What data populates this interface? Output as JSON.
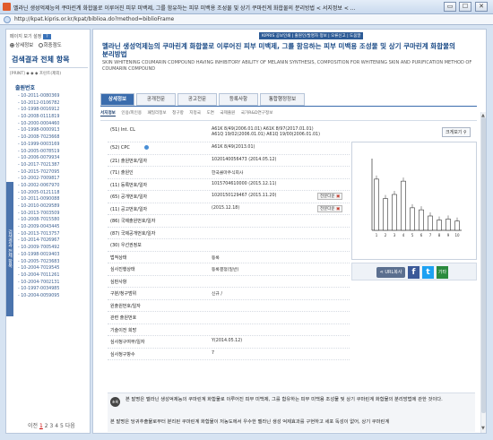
{
  "window": {
    "title": "멜라닌 생성억제능의 쿠마린계 화합물로 이루어진 피부 미백제, 그를 함유하는 피부 미백용 조성물 및 상기 쿠마린계 화합물의 분리방법 < 서지정보 < ...",
    "btn_min": "▭",
    "btn_max": "☐",
    "btn_close": "✕"
  },
  "address": {
    "url": "http://kpat.kipris.or.kr/kpat/biblioa.do?method=biblioFrame"
  },
  "left": {
    "register_label": "페이지 보기 설정",
    "register_btn": "?",
    "radio1": "상세정보",
    "radio2": "회중점도",
    "results_title": "검색결과 전체 항목",
    "print_row": "[PRINT] ◆ ◆ ◆ 프린트(제외)",
    "doc_header": "출원번호",
    "numbers": [
      "10-2011-0080369",
      "10-2012-0106782",
      "10-1998-0016912",
      "10-2008-0111819",
      "10-2000-0004460",
      "10-1998-0000913",
      "10-2008-7023668",
      "10-1999-0003169",
      "10-2005-0078519",
      "10-2006-0079934",
      "10-2017-7021387",
      "10-2015-7027095",
      "10-2002-7009817",
      "10-2002-0067970",
      "10-2005-0121118",
      "10-2011-0090088",
      "10-2010-0029589",
      "10-2013-7003509",
      "10-2008-7015580",
      "10-2009-0043445",
      "10-2013-7013757",
      "10-2014-7026967",
      "10-2009-7005492",
      "10-1998-0019403",
      "10-2005-7023683",
      "10-2004-7019545",
      "10-2004-7011261",
      "10-2004-7002131",
      "10-1997-0034985",
      "10-2004-0059095"
    ],
    "vertical_tab": "검색결과 전체 항목",
    "pager": {
      "prev": "이전",
      "pages": [
        "1",
        "2",
        "3",
        "4",
        "5"
      ],
      "next": "다음"
    }
  },
  "main": {
    "topbar": "KIPRIS 공보인쇄 | 출원인/발명자 정보 | 오류신고 | 도움말",
    "title": "멜라닌 생성억제능의 쿠마린계 화합물로 이루어진 피부 미백제, 그를 함유하는 피부 미백용 조성물 및 상기 쿠마린계 화합물의 분리방법",
    "eng_title": "SKIN WHITENING COUMARIN COMPOUND HAVING INHIBITORY ABILITY OF MELANIN SYNTHESIS, COMPOSITION FOR WHITENING SKIN AND PURIFICATION METHOD OF COUMARIN COMPOUND",
    "tabs": [
      "상세정보",
      "공개전문",
      "공고전문",
      "등록사항",
      "통합행정정보"
    ],
    "subtabs": [
      "서지정보",
      "인용/피인용",
      "패밀리정보",
      "청구항",
      "지정국",
      "도면",
      "국제출원",
      "국가R&D연구정보"
    ],
    "rows": [
      {
        "label": "(51) Int. CL",
        "v1": "A61K 8/49(2006.01.01) A61K 8/97(2017.01.01)",
        "v2": "A61Q 19/02(2006.01.01) A61Q 19/00(2006.01.01)"
      },
      {
        "label": "(52) CPC",
        "v1": "A61K 8/49(2013.01)"
      },
      {
        "label": "(21) 출원번호/일자",
        "v1": "1020140056473 (2014.05.12)"
      },
      {
        "label": "(71) 출원인",
        "v1": "한국콜마주식회사"
      },
      {
        "label": "(11) 등록번호/일자",
        "v1": "1015704610000 (2015.12.11)"
      },
      {
        "label": "(65) 공개번호/일자",
        "v1": "1020150129467 (2015.11.20)",
        "btn": "전문다운"
      },
      {
        "label": "(11) 공고번호/일자",
        "v1": "(2015.12.18)",
        "btn": "전문다운"
      },
      {
        "label": "(86) 국제출원번호/일자",
        "v1": ""
      },
      {
        "label": "(87) 국제공개번호/일자",
        "v1": ""
      },
      {
        "label": "(30) 우선권정보",
        "v1": ""
      },
      {
        "label": "법적상태",
        "v1": "등록"
      },
      {
        "label": "심사진행상태",
        "v1": "등록결정(일반)"
      },
      {
        "label": "심판사항",
        "v1": ""
      },
      {
        "label": "구분/청구범위",
        "v1": "신규 /"
      },
      {
        "label": "원출원번호/일자",
        "v1": ""
      },
      {
        "label": "관련 출원번호",
        "v1": ""
      },
      {
        "label": "기술이전 희망",
        "v1": ""
      },
      {
        "label": "심사청구여부/일자",
        "v1": "Y(2014.05.12)"
      },
      {
        "label": "심사청구항수",
        "v1": "7"
      }
    ],
    "enlarge": "크게보기",
    "share": "URL복사",
    "share_other": "기타",
    "abstract_label": "초록",
    "abstract_line1": "본 발명은 멜라닌 생성억제능의 쿠마린계 화합물로 이루어진 피부 미백제, 그를 함유하는 피부 미백용 조성물 및 상기 쿠마린계 화합물의 분리방법에 관한 것이다.",
    "abstract_line2": "본 발명은 당귀추출물로부터 분리된 쿠마린계 화합물이 저농도에서 우수한 멜라닌 생성 억제효과를 구현하고 세포 독성이 없어, 상기 쿠마린계"
  },
  "chart_data": {
    "type": "bar",
    "categories": [
      "1",
      "2",
      "3",
      "4",
      "5",
      "6",
      "7",
      "8",
      "9",
      "10"
    ],
    "values": [
      100,
      62,
      70,
      96,
      44,
      40,
      28,
      20,
      22,
      18
    ],
    "title": "",
    "xlabel": "",
    "ylabel": "",
    "ylim": [
      0,
      140
    ],
    "grid": false
  }
}
